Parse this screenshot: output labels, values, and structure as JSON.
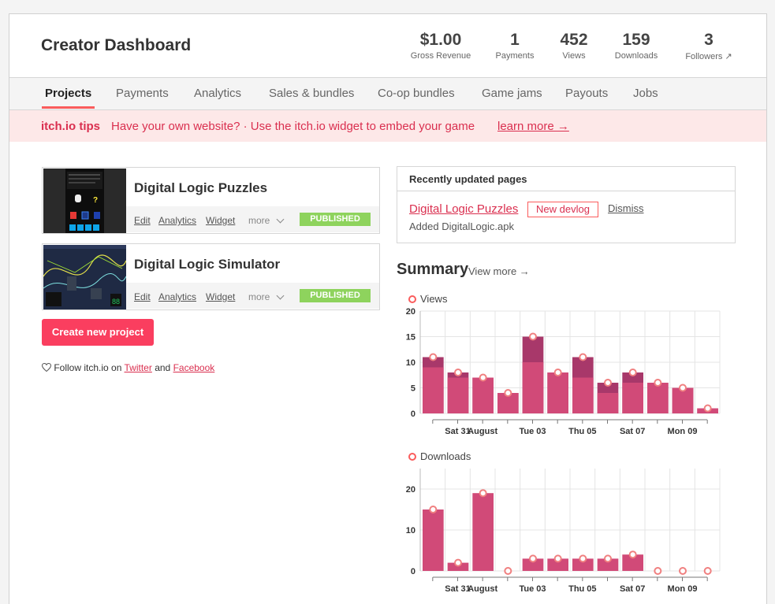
{
  "header": {
    "title": "Creator Dashboard",
    "stats": [
      {
        "value": "$1.00",
        "label": "Gross Revenue"
      },
      {
        "value": "1",
        "label": "Payments"
      },
      {
        "value": "452",
        "label": "Views"
      },
      {
        "value": "159",
        "label": "Downloads"
      },
      {
        "value": "3",
        "label": "Followers ↗"
      }
    ]
  },
  "nav": {
    "tabs": [
      "Projects",
      "Payments",
      "Analytics",
      "Sales & bundles",
      "Co-op bundles",
      "Game jams",
      "Payouts",
      "Jobs"
    ],
    "active": "Projects"
  },
  "tips": {
    "label": "itch.io tips",
    "text": "Have your own website? · Use the itch.io widget to embed your game",
    "link": "learn more →"
  },
  "projects": [
    {
      "title": "Digital Logic Puzzles",
      "links": [
        "Edit",
        "Analytics",
        "Widget"
      ],
      "more": "more",
      "status": "PUBLISHED"
    },
    {
      "title": "Digital Logic Simulator",
      "links": [
        "Edit",
        "Analytics",
        "Widget"
      ],
      "more": "more",
      "status": "PUBLISHED"
    }
  ],
  "create_button": "Create new project",
  "follow": {
    "prefix": "Follow itch.io on",
    "twitter": "Twitter",
    "and": "and",
    "facebook": "Facebook"
  },
  "recent": {
    "title": "Recently updated pages",
    "page": "Digital Logic Puzzles",
    "tag": "New devlog",
    "dismiss": "Dismiss",
    "desc": "Added DigitalLogic.apk"
  },
  "summary": {
    "title": "Summary",
    "view_more": "View more →"
  },
  "colors": {
    "accent": "#fa5c5c",
    "bar": "#d14a78",
    "bar_dark": "#a8386a",
    "published": "#8ed35d"
  },
  "chart_data": [
    {
      "type": "bar",
      "title": "Views",
      "x_ticks": [
        "Sat 31",
        "August",
        "Tue 03",
        "Thu 05",
        "Sat 07",
        "Mon 09"
      ],
      "ylim": [
        0,
        20
      ],
      "y_ticks": [
        0,
        5,
        10,
        15,
        20
      ],
      "series": [
        {
          "name": "Views",
          "values": [
            11,
            8,
            7,
            4,
            15,
            8,
            11,
            6,
            8,
            6,
            5,
            1
          ]
        },
        {
          "values": [
            9,
            7,
            7,
            4,
            10,
            8,
            7,
            4,
            6,
            6,
            5,
            1
          ]
        }
      ],
      "grid": true
    },
    {
      "type": "bar",
      "title": "Downloads",
      "x_ticks": [
        "Sat 31",
        "August",
        "Tue 03",
        "Thu 05",
        "Sat 07",
        "Mon 09"
      ],
      "ylim": [
        0,
        25
      ],
      "y_ticks": [
        0,
        10,
        20
      ],
      "series": [
        {
          "name": "Downloads",
          "values": [
            15,
            2,
            19,
            0,
            3,
            3,
            3,
            3,
            4,
            0,
            0,
            0
          ]
        }
      ],
      "grid": true
    }
  ]
}
